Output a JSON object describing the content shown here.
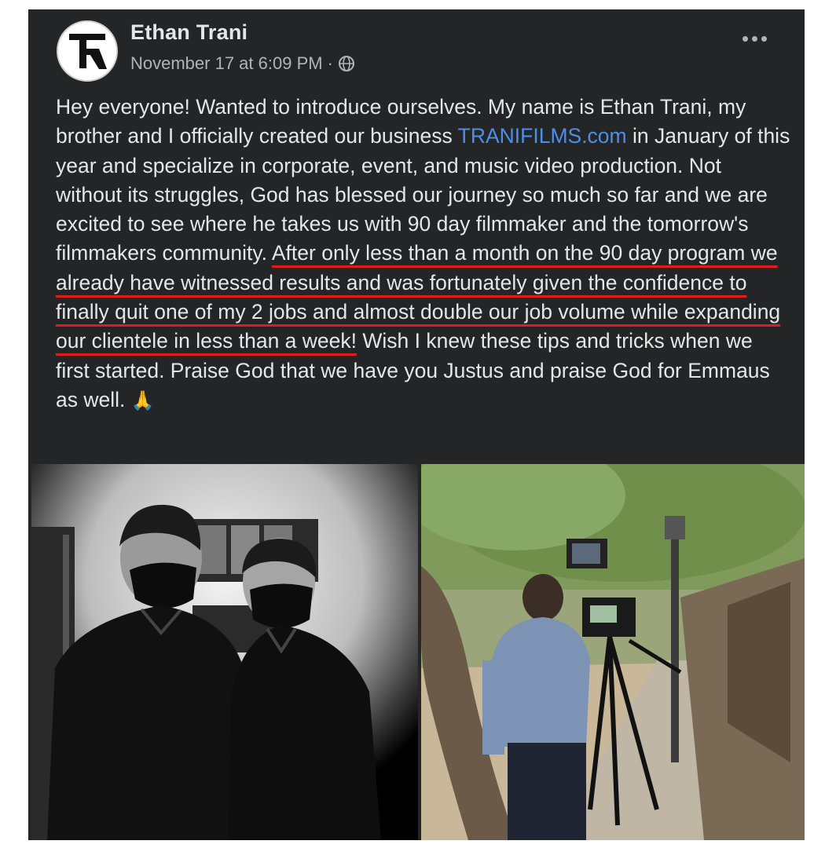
{
  "post": {
    "author": "Ethan Trani",
    "timestamp": "November 17 at 6:09 PM",
    "separator": "·",
    "privacy_icon": "globe-icon",
    "more_icon": "more-options-icon",
    "text": {
      "p1": "Hey everyone! Wanted to introduce ourselves. My name is Ethan Trani, my brother and I officially created our business ",
      "link": "TRANIFILMS.com",
      "p2": " in January of this year and specialize in corporate, event, and music video production. Not without its struggles, God has blessed our journey so much so far and we are excited to see where he takes us with 90 day filmmaker and the tomorrow's filmmakers community. ",
      "highlight": "After only less than a month on the 90 day program we already have witnessed results and was fortunately given the confidence to finally quit one of my 2 jobs and almost double our job volume while expanding our clientele in less than a week!",
      "p3": " Wish I knew these tips and tricks when we first started. Praise God that we have you Justus and praise God for Emmaus as well. ",
      "emoji": "🙏"
    },
    "photos": [
      "photo-two-brothers-masks",
      "photo-camera-operator-outdoors"
    ]
  },
  "colors": {
    "card_bg": "#242526",
    "text": "#e4e6eb",
    "meta": "#b0b3b8",
    "link": "#4d8fe8",
    "annotation_underline": "#e21b1b"
  }
}
